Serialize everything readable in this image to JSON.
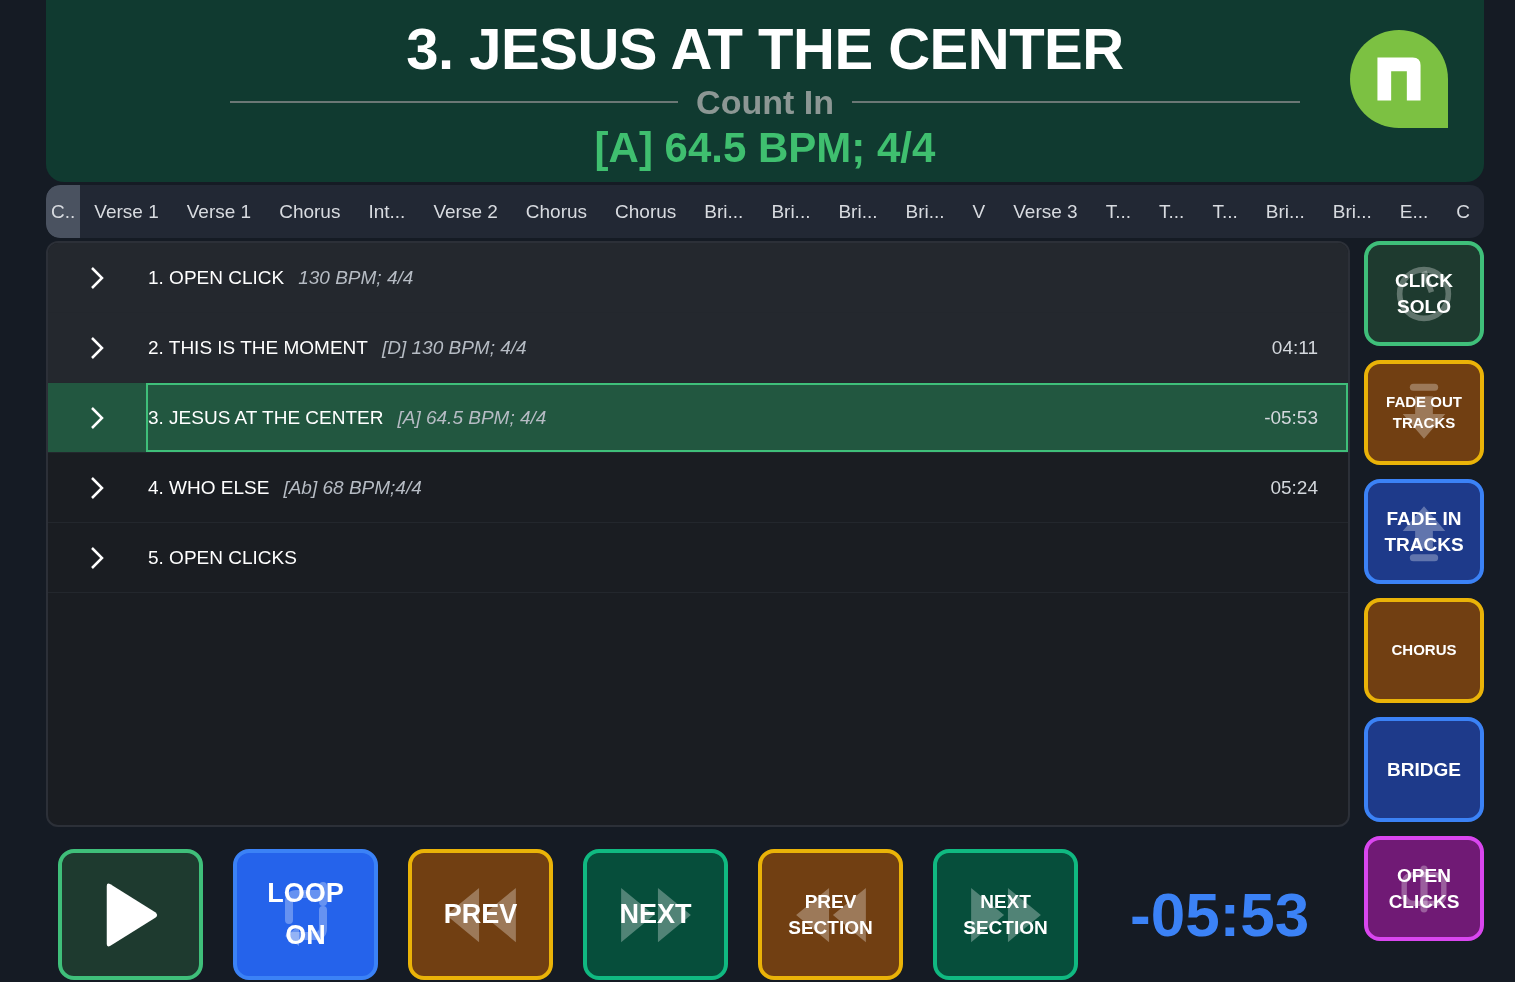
{
  "header": {
    "title": "3. JESUS AT THE CENTER",
    "section": "Count In",
    "song_info": "[A] 64.5 BPM; 4/4"
  },
  "sections": [
    {
      "label": "C..",
      "selected": true
    },
    {
      "label": "Verse 1",
      "selected": false
    },
    {
      "label": "Verse 1",
      "selected": false
    },
    {
      "label": "Chorus",
      "selected": false
    },
    {
      "label": "Int...",
      "selected": false
    },
    {
      "label": "Verse 2",
      "selected": false
    },
    {
      "label": "Chorus",
      "selected": false
    },
    {
      "label": "Chorus",
      "selected": false
    },
    {
      "label": "Bri...",
      "selected": false
    },
    {
      "label": "Bri...",
      "selected": false
    },
    {
      "label": "Bri...",
      "selected": false
    },
    {
      "label": "Bri...",
      "selected": false
    },
    {
      "label": "V",
      "selected": false
    },
    {
      "label": "Verse 3",
      "selected": false
    },
    {
      "label": "T...",
      "selected": false
    },
    {
      "label": "T...",
      "selected": false
    },
    {
      "label": "T...",
      "selected": false
    },
    {
      "label": "Bri...",
      "selected": false
    },
    {
      "label": "Bri...",
      "selected": false
    },
    {
      "label": "E...",
      "selected": false
    },
    {
      "label": "C",
      "selected": false
    }
  ],
  "songs": [
    {
      "title": "1. OPEN CLICK",
      "info": "130 BPM; 4/4",
      "played": true,
      "selected": false
    },
    {
      "title": "2. THIS IS THE MOMENT",
      "info": "[D] 130 BPM; 4/4",
      "time": "04:11",
      "played": true,
      "selected": false
    },
    {
      "title": "3. JESUS AT THE CENTER",
      "info": "[A] 64.5 BPM; 4/4",
      "time": "-05:53",
      "played": false,
      "selected": true
    },
    {
      "title": "4. WHO ELSE",
      "info": "[Ab] 68 BPM;4/4",
      "time": "05:24",
      "played": false,
      "selected": false
    },
    {
      "title": "5. OPEN CLICKS",
      "played": false,
      "selected": false
    }
  ],
  "side_buttons": [
    {
      "label": "CLICK SOLO",
      "kind": "click"
    },
    {
      "label": "FADE OUT TRACKS",
      "kind": "fadeout"
    },
    {
      "label": "FADE IN TRACKS",
      "kind": "fadein"
    },
    {
      "label": "CHORUS",
      "kind": "chorus"
    },
    {
      "label": "BRIDGE",
      "kind": "bridge"
    },
    {
      "label": "OPEN CLICKS",
      "kind": "clicks"
    }
  ],
  "transport": [
    {
      "kind": "play"
    },
    {
      "label": "LOOP ON",
      "kind": "loop"
    },
    {
      "label": "PREV",
      "kind": "prev"
    },
    {
      "label": "NEXT",
      "kind": "next"
    },
    {
      "label": "PREV SECTION",
      "kind": "prevsection"
    },
    {
      "label": "NEXT SECTION",
      "kind": "nextsection"
    }
  ],
  "timer": "-05:53"
}
